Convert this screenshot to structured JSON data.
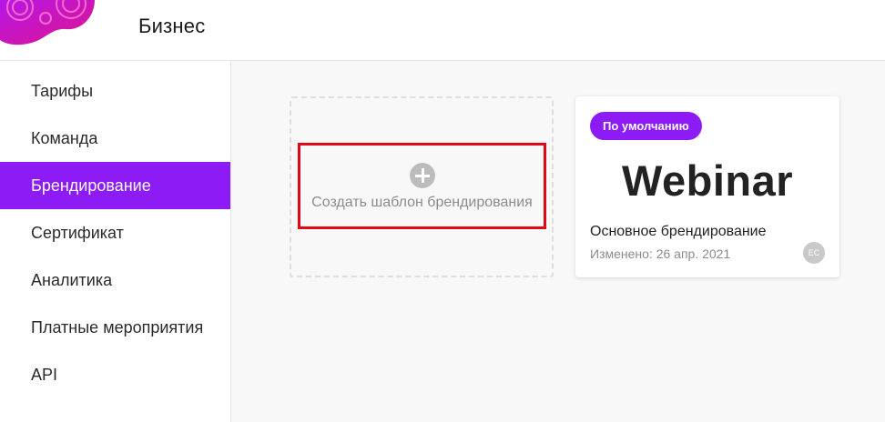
{
  "header": {
    "title": "Бизнес"
  },
  "sidebar": {
    "items": [
      {
        "label": "Тарифы",
        "active": false
      },
      {
        "label": "Команда",
        "active": false
      },
      {
        "label": "Брендирование",
        "active": true
      },
      {
        "label": "Сертификат",
        "active": false
      },
      {
        "label": "Аналитика",
        "active": false
      },
      {
        "label": "Платные мероприятия",
        "active": false
      },
      {
        "label": "API",
        "active": false
      }
    ]
  },
  "main": {
    "create_card": {
      "label": "Создать шаблон брендирования",
      "icon": "plus-circle-icon"
    },
    "templates": [
      {
        "badge": "По умолчанию",
        "logo_text": "Webinar",
        "name": "Основное брендирование",
        "modified": "Изменено: 26 апр. 2021",
        "avatar_initials": "EC"
      }
    ]
  },
  "colors": {
    "accent": "#8d1bf5",
    "highlight": "#e30613",
    "background": "#f8f8f8"
  }
}
